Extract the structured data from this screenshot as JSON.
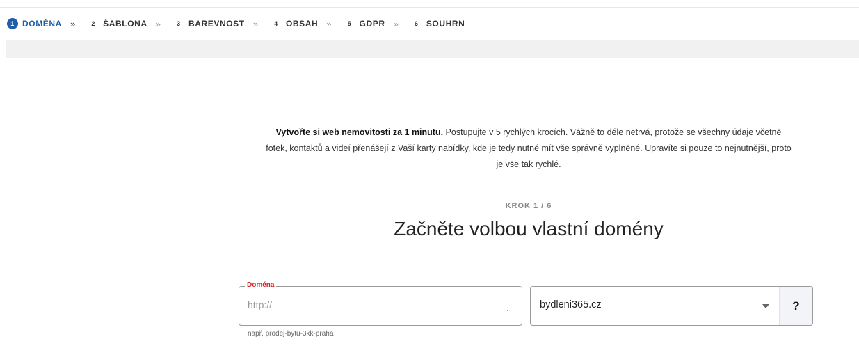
{
  "stepper": {
    "steps": [
      {
        "num": "1",
        "label": "DOMÉNA",
        "active": true
      },
      {
        "num": "2",
        "label": "ŠABLONA"
      },
      {
        "num": "3",
        "label": "BAREVNOST"
      },
      {
        "num": "4",
        "label": "OBSAH"
      },
      {
        "num": "5",
        "label": "GDPR"
      },
      {
        "num": "6",
        "label": "SOUHRN"
      }
    ],
    "separator": "»"
  },
  "intro": {
    "bold": "Vytvořte si web nemovitosti za 1 minutu.",
    "text": " Postupujte v 5 rychlých krocích. Vážně to déle netrvá, protože se všechny údaje včetně fotek, kontaktů a videí přenášejí z Vaší karty nabídky, kde je tedy nutné mít vše správně vyplněné. Upravíte si pouze to nejnutnější, proto je vše tak rychlé."
  },
  "step_label": "KROK 1 / 6",
  "headline": "Začněte volbou vlastní domény",
  "domain_field": {
    "legend": "Doména",
    "placeholder": "http://",
    "suffix_dot": ".",
    "hint": "např. prodej-bytu-3kk-praha"
  },
  "domain_select": {
    "value": "bydleni365.cz",
    "help_label": "?"
  },
  "colors": {
    "accent": "#1e5fa8",
    "error_label": "#d0242b"
  }
}
